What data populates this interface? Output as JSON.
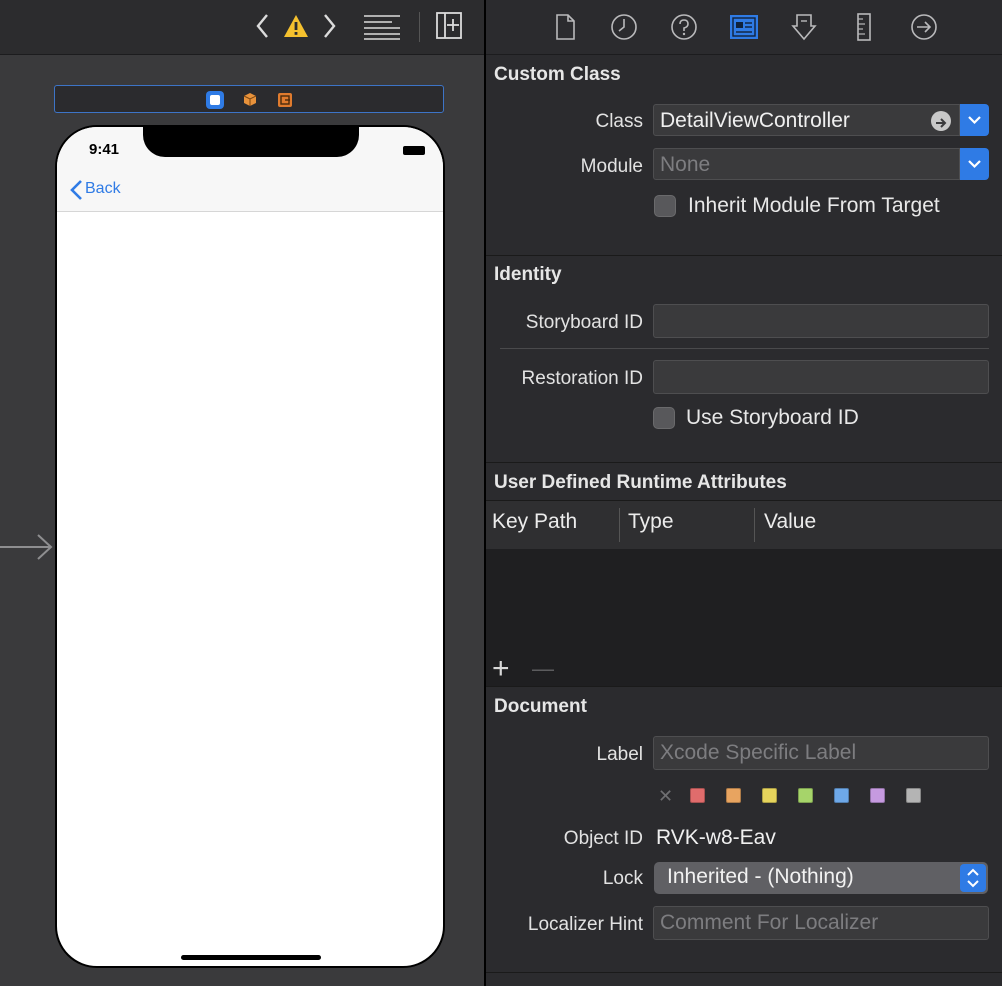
{
  "phone": {
    "time": "9:41",
    "back_label": "Back"
  },
  "custom_class": {
    "title": "Custom Class",
    "class_label": "Class",
    "class_value": "DetailViewController",
    "module_label": "Module",
    "module_placeholder": "None",
    "inherit_label": "Inherit Module From Target"
  },
  "identity": {
    "title": "Identity",
    "storyboard_id_label": "Storyboard ID",
    "storyboard_id_value": "",
    "restoration_id_label": "Restoration ID",
    "restoration_id_value": "",
    "use_storyboard_label": "Use Storyboard ID"
  },
  "runtime_attrs": {
    "title": "User Defined Runtime Attributes",
    "columns": [
      "Key Path",
      "Type",
      "Value"
    ],
    "add": "+",
    "remove": "—"
  },
  "document": {
    "title": "Document",
    "label_label": "Label",
    "label_placeholder": "Xcode Specific Label",
    "clear_symbol": "✕",
    "swatches": [
      "#e06c6c",
      "#e8a460",
      "#e6d45c",
      "#a6d46a",
      "#6ea8e8",
      "#c69ae0",
      "#b4b4b4"
    ],
    "object_id_label": "Object ID",
    "object_id_value": "RVK-w8-Eav",
    "lock_label": "Lock",
    "lock_value": "Inherited - (Nothing)",
    "localizer_label": "Localizer Hint",
    "localizer_placeholder": "Comment For Localizer"
  },
  "colors": {
    "accent": "#2f7be5",
    "warning": "#f5c12e"
  }
}
